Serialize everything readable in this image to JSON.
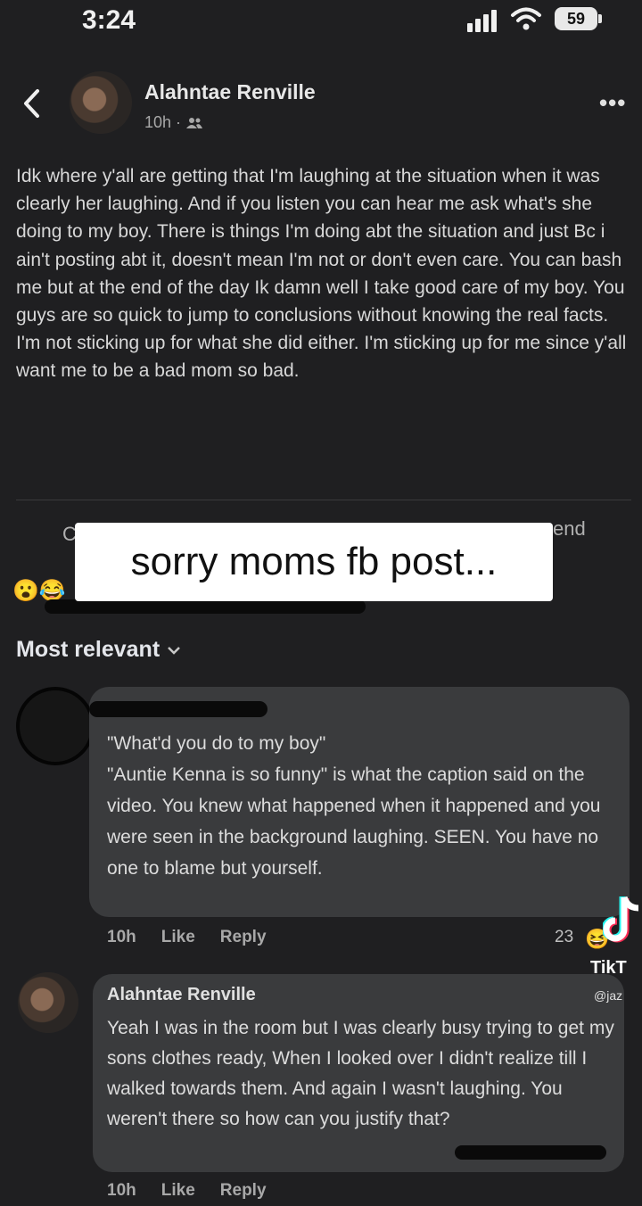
{
  "status_bar": {
    "time": "3:24",
    "battery": "59",
    "icons": [
      "signal-icon",
      "wifi-icon",
      "battery-icon"
    ]
  },
  "header": {
    "author": "Alahntae Renville",
    "timestamp": "10h ·",
    "icons": [
      "back-icon",
      "friends-icon",
      "more-icon"
    ]
  },
  "post": {
    "text": "Idk where y'all are getting that I'm laughing at the situation when it was clearly her laughing. And if you listen you can hear me ask what's she doing to my boy. There is things I'm doing abt the situation and just Bc i ain't posting abt it, doesn't mean I'm not or don't even care. You can bash me but at the end of the day Ik damn well I take good care of my boy. You guys are so quick to jump to conclusions without knowing the real facts. I'm not sticking up for what she did either. I'm sticking up for me since y'all want me to be a bad mom so bad."
  },
  "actions": {
    "fragment_left": "C",
    "fragment_right": "end"
  },
  "overlay": {
    "caption": "sorry moms fb post..."
  },
  "sort": {
    "label": "Most relevant"
  },
  "comments": [
    {
      "text": "\"What'd you do to my boy\"\n\"Auntie Kenna is so funny\" is what the caption said on the video. You knew what happened when it happened and you were seen in the background laughing. SEEN. You have no one to blame but yourself.",
      "time": "10h",
      "like": "Like",
      "reply": "Reply",
      "reactions": "23"
    },
    {
      "author": "Alahntae Renville",
      "text": "Yeah I was in the room but I was clearly busy trying to get my sons clothes ready, When I looked over I didn't realize till I walked towards them. And again I wasn't laughing. You weren't there so how can you justify that?",
      "time": "10h",
      "like": "Like",
      "reply": "Reply"
    }
  ],
  "watermark": {
    "name": "TikT",
    "handle": "@jaz"
  },
  "colors": {
    "background": "#1f1f21",
    "bubble": "#3a3b3d",
    "caption_bg": "#ffffff"
  }
}
